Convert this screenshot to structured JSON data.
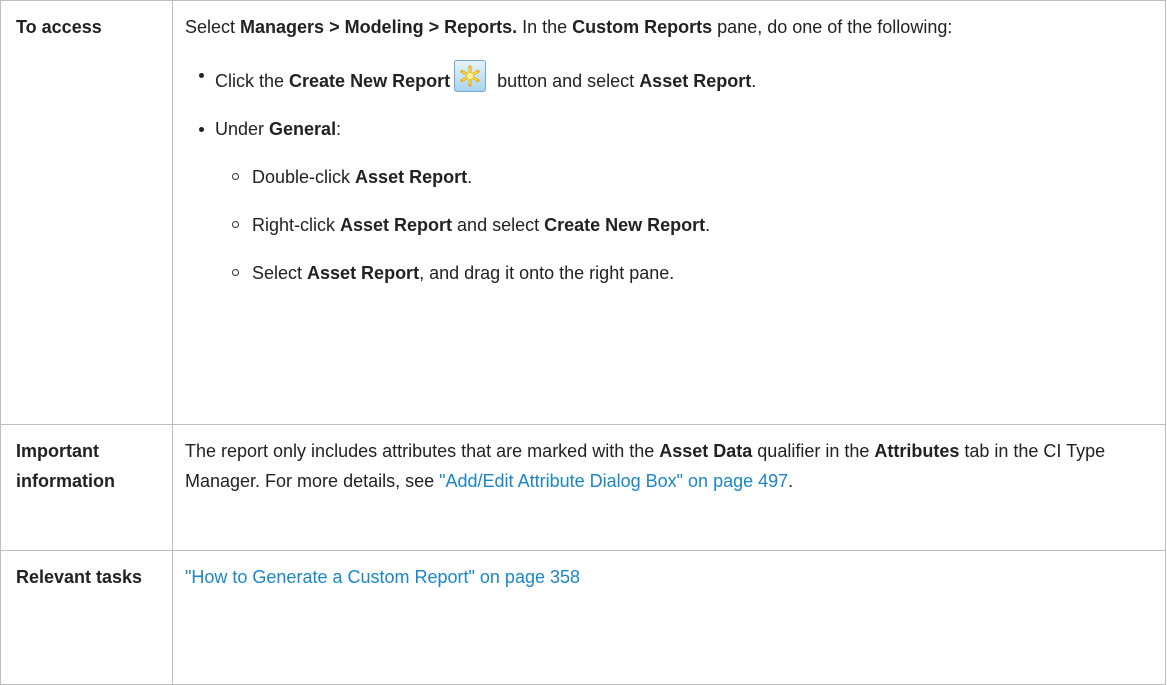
{
  "rows": [
    {
      "header": "To access",
      "intro": {
        "t1": "Select ",
        "b1": "Managers > Modeling > Reports.",
        "t2": " In the ",
        "b2": "Custom Reports",
        "t3": " pane, do one of the following:"
      },
      "bullet1": {
        "t1": "Click the ",
        "b1": "Create New Report",
        "icon": "create-new-report-star-icon",
        "t2": " button and select ",
        "b2": "Asset Report",
        "t3": "."
      },
      "bullet2": {
        "t1": "Under ",
        "b1": "General",
        "t2": ":"
      },
      "sub1": {
        "t1": "Double-click ",
        "b1": "Asset Report",
        "t2": "."
      },
      "sub2": {
        "t1": "Right-click ",
        "b1": "Asset Report",
        "t2": " and select ",
        "b2": "Create New Report",
        "t3": "."
      },
      "sub3": {
        "t1": "Select ",
        "b1": "Asset Report",
        "t2": ", and drag it onto the right pane."
      }
    },
    {
      "header": "Important information",
      "t1": "The report only includes attributes that are marked with the ",
      "b1": "Asset Data",
      "t2": " qualifier in the ",
      "b2": "Attributes",
      "t3": " tab in the CI Type Manager. For more details, see ",
      "link": "\"Add/Edit Attribute Dialog Box\" on page 497",
      "t4": "."
    },
    {
      "header": "Relevant tasks",
      "link": "\"How to Generate a Custom Report\" on page 358"
    }
  ],
  "colors": {
    "link": "#1a86c8",
    "border": "#bdbdbd",
    "text": "#222222"
  }
}
